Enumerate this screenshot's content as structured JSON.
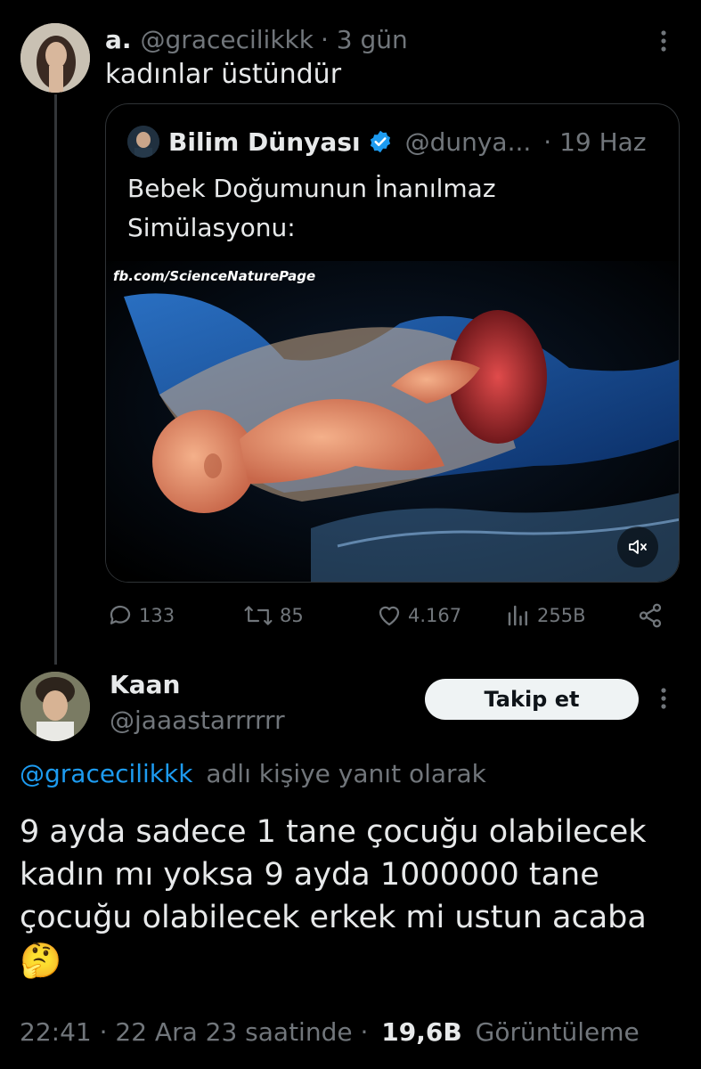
{
  "first_tweet": {
    "display_name": "a.",
    "handle": "@gracecilikkk",
    "time": "· 3 gün",
    "text": "kadınlar üstündür",
    "more_icon": "more-dots-icon"
  },
  "quoted_tweet": {
    "display_name": "Bilim Dünyası",
    "verified_icon": "verified-badge-icon",
    "handle": "@dunya...",
    "time": "· 19 Haz",
    "text_line1": "Bebek Doğumunun İnanılmaz",
    "text_line2": "Simülasyonu:",
    "media_watermark": "fb.com/ScienceNaturePage",
    "mute_icon": "speaker-muted-icon"
  },
  "actions": {
    "replies": "133",
    "retweets": "85",
    "likes": "4.167",
    "views": "255B"
  },
  "reply_tweet": {
    "display_name": "Kaan",
    "handle": "@jaaastarrrrrr",
    "follow_label": "Takip et",
    "reply_to_handle": "@gracecilikkk",
    "reply_to_suffix": "adlı kişiye yanıt olarak",
    "text": "9 ayda sadece 1 tane çocuğu olabilecek kadın mı yoksa 9 ayda 1000000 tane çocuğu olabilecek erkek mi ustun acaba",
    "emoji": "🤔",
    "timestamp": "22:41 · 22 Ara 23 saatinde ·",
    "view_count": "19,6B",
    "view_label": "Görüntüleme"
  },
  "colors": {
    "background": "#000000",
    "text": "#e7e9ea",
    "muted": "#71767b",
    "link": "#1d9bf0",
    "border": "#2f3336"
  }
}
